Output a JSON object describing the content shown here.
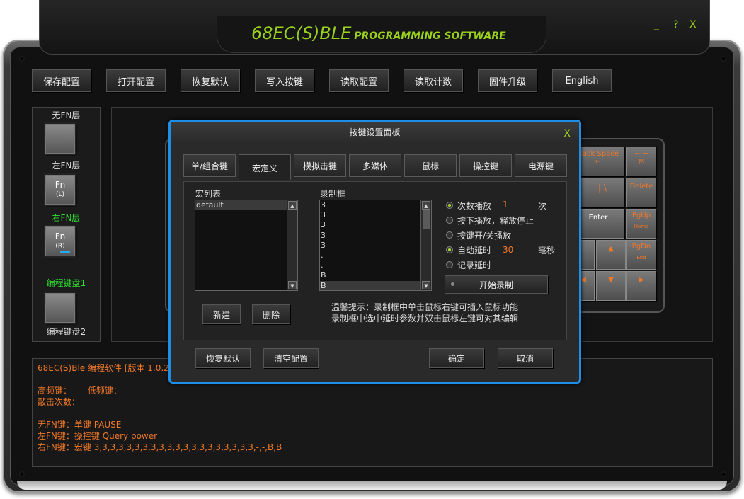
{
  "window": {
    "title_main": "68EC(S)BLE",
    "title_sub": "PROGRAMMING SOFTWARE",
    "minimize": "_",
    "help": "?",
    "close": "X"
  },
  "toolbar": [
    "保存配置",
    "打开配置",
    "恢复默认",
    "写入按键",
    "读取配置",
    "读取计数",
    "固件升级",
    "English"
  ],
  "layers": {
    "no_fn": "无FN层",
    "left_fn": "左FN层",
    "right_fn": "右FN层",
    "fn": "Fn",
    "l": "(L)",
    "r": "(R)",
    "prog1": "编程键盘1",
    "prog2": "编程键盘2"
  },
  "keyboard": {
    "backspace": "Back Space",
    "backspace_arrow": "←",
    "tilde": "~ ~",
    "m": "M",
    "pipe": "| \\",
    "delete": "Delete",
    "enter": "Enter",
    "pgup": "PgUp",
    "home": "Home",
    "pgdn": "PgDn",
    "end": "End",
    "up": "▲",
    "left": "◀",
    "down": "▼",
    "right": "▶"
  },
  "dialog": {
    "title": "按键设置面板",
    "close": "X",
    "tabs": [
      "单/组合键",
      "宏定义",
      "模拟击键",
      "多媒体",
      "鼠标",
      "操控键",
      "电源键"
    ],
    "macro_list_label": "宏列表",
    "macro_list": [
      "default"
    ],
    "record_label": "录制框",
    "record_items": [
      "3",
      "3",
      "3",
      "3",
      "3",
      ".",
      ".",
      "B",
      "B"
    ],
    "new_btn": "新建",
    "delete_btn": "删除",
    "opt_count": "次数播放",
    "count_value": "1",
    "count_unit": "次",
    "opt_hold": "按下播放，释放停止",
    "opt_toggle": "按键开/关播放",
    "opt_autodelay": "自动延时",
    "delay_value": "30",
    "delay_unit": "毫秒",
    "opt_recdelay": "记录延时",
    "start_record": "开始录制",
    "hint1": "温馨提示：录制框中单击鼠标右键可插入鼠标功能",
    "hint2": "录制框中选中延时参数并双击鼠标左键可对其编辑",
    "restore_btn": "恢复默认",
    "clear_btn": "清空配置",
    "ok_btn": "确定",
    "cancel_btn": "取消"
  },
  "log": [
    "68EC(S)Ble 编程软件 [版本 1.0.2]",
    "",
    "高频键：      低频键：",
    "敲击次数：",
    "",
    "无FN键：单键 PAUSE",
    "左FN键：操控键 Query power",
    "右FN键：宏键 3,3,3,3,3,3,3,3,3,3,3,3,3,3,3,3,3,3,3,3,-,-,B,B"
  ]
}
